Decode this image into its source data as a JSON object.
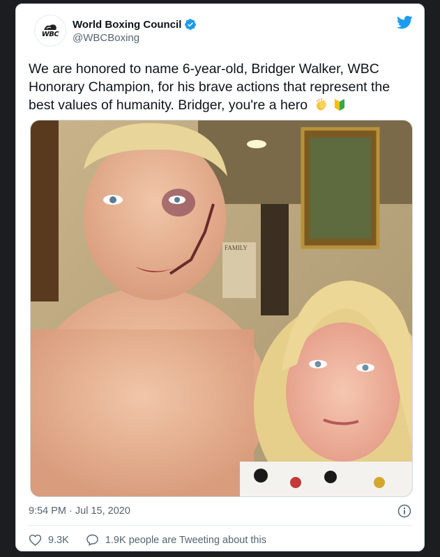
{
  "tweet": {
    "author": {
      "display_name": "World Boxing Council",
      "handle": "@WBCBoxing",
      "avatar_text": "WBC",
      "verified": true
    },
    "platform_icon": "twitter-bird-icon",
    "text": "We are honored to name 6-year-old, Bridger Walker, WBC Honorary Champion, for his brave actions that represent the best values of humanity. Bridger, you're a hero",
    "emoji": [
      "clapping-hands-icon",
      "japanese-beginner-symbol-icon"
    ],
    "timestamp": "9:54 PM · Jul 15, 2020",
    "likes": "9.3K",
    "replies_text": "1.9K people are Tweeting about this"
  },
  "colors": {
    "brand_blue": "#1d9bf0",
    "text_primary": "#0f1419",
    "text_secondary": "#536471",
    "background": "#1b1d20"
  }
}
